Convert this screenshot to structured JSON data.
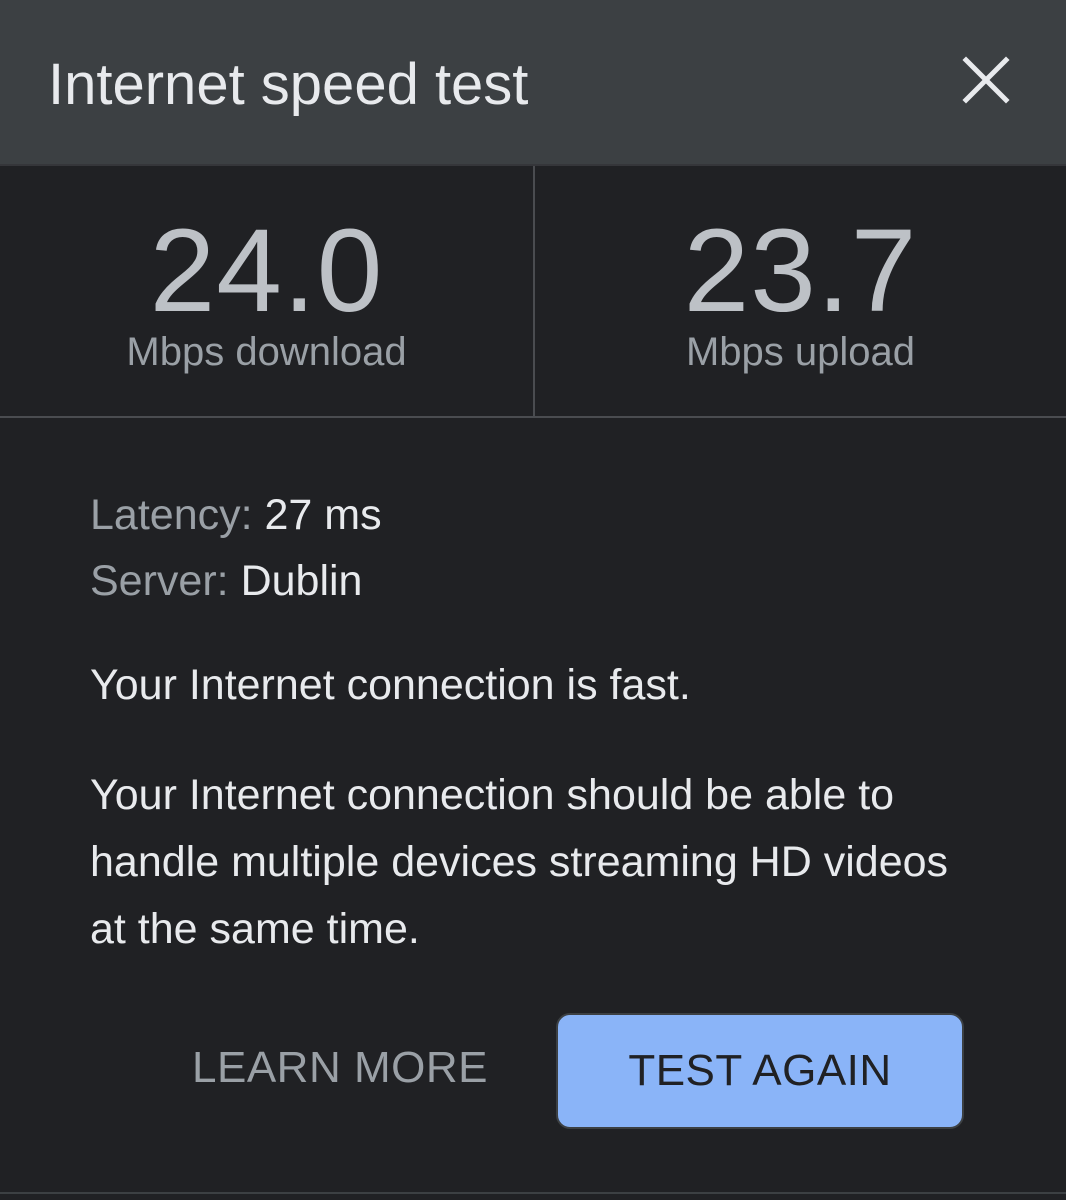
{
  "dialog": {
    "title": "Internet speed test",
    "close_icon": "close-icon"
  },
  "metrics": {
    "download": {
      "value": "24.0",
      "label": "Mbps download"
    },
    "upload": {
      "value": "23.7",
      "label": "Mbps upload"
    }
  },
  "details": {
    "latency_label": "Latency:",
    "latency_value": "27 ms",
    "server_label": "Server:",
    "server_value": "Dublin"
  },
  "status": "Your Internet connection is fast.",
  "description": "Your Internet connection should be able to handle multiple devices streaming HD videos at the same time.",
  "actions": {
    "learn_more": "LEARN MORE",
    "test_again": "TEST AGAIN"
  },
  "colors": {
    "background": "#202124",
    "header": "#3c4043",
    "accent": "#8ab4f8",
    "text_primary": "#e8eaed",
    "text_secondary": "#9aa0a6"
  }
}
